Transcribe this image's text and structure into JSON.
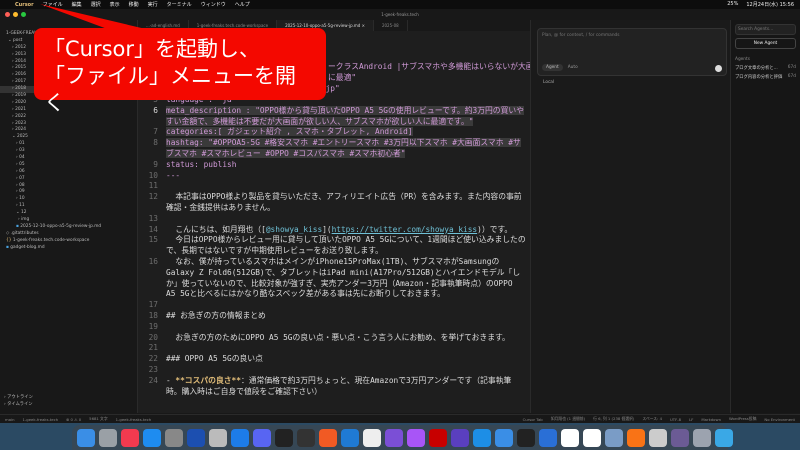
{
  "menubar": {
    "app": "Cursor",
    "items": [
      "ファイル",
      "編集",
      "選択",
      "表示",
      "移動",
      "実行",
      "ターミナル",
      "ウィンドウ",
      "ヘルプ"
    ],
    "battery": "25%",
    "datetime": "12月24日(水)  15:56"
  },
  "window": {
    "title": "1-geek-freaks.tech"
  },
  "sidebar": {
    "root": "1-GEEK-FREAKS",
    "folder": "post",
    "years": [
      "2012",
      "2013",
      "2014",
      "2015",
      "2016",
      "2017",
      "2018",
      "2019",
      "2020",
      "2021",
      "2022",
      "2023",
      "2024",
      "2025"
    ],
    "months": [
      "01",
      "03",
      "04",
      "05",
      "06",
      "07",
      "08",
      "09",
      "10",
      "11",
      "12"
    ],
    "subfolder": "img",
    "file": "2025-12-10-oppo-a5-5g-review-jp.md",
    "root_files": [
      ".gitattributes",
      "1-geek-freaks.tech.code-workspace",
      "gadget-blog.md"
    ],
    "outline": "アウトライン",
    "timeline": "タイムライン"
  },
  "tabs": [
    "...-ad-english.md",
    "1-geek-freaks.tech.code-workspace",
    "2025-12-10-oppo-a5-5g-review-jp.md",
    "2025-08"
  ],
  "code": {
    "l3a": "ークラスAndroid |サブスマホや多機能はいらないが大画面",
    "l3b": "に最適\"",
    "l4": "slug: \"20251209-oppo-a5-5g-review-jp\"",
    "l5": "language : \"ja\"",
    "l6k": "meta_description : ",
    "l6v": "\"OPPO様から貸与頂いたOPPO A5 5Gの使用レビューです。約3万円の買いやすい金額で、多機能は不要だが大画面が欲しい人、サブスマホが欲しい人に最適です。\"",
    "l7": "categories:[ ガジェット紹介 , スマホ・タブレット, Android]",
    "l8": "hashtag: \"#OPPOA5-5G #格安スマホ #エントリースマホ #3万円以下スマホ #大画面スマホ #サブスマホ #スマホレビュー #OPPO #コスパスマホ #スマホ初心者\"",
    "l9k": "status: ",
    "l9v": "publish",
    "l10": "---",
    "l12": "  本記事はOPPO様より製品を貸与いただき、アフィリエイト広告（PR）を含みます。また内容の事前確認・金銭提供はありません。",
    "l14a": "  こんにちは、如月翔也（[",
    "l14m": "@showya_kiss",
    "l14b": "](",
    "l14l": "https://twitter.com/showya_kiss",
    "l14c": ")）です。",
    "l15": "  今日はOPPO様からレビュー用に貸与して頂いたOPPO A5 5Gについて、1週間ほど使い込みましたので、長期ではないですが中期使用レビューをお送り致します。",
    "l16": "  なお、僕が持っているスマホはメインがiPhone15ProMax(1TB)、サブスマホがSamsungのGalaxy Z Fold6(512GB)で、タブレットはiPad mini(A17Pro/512GB)とハイエンドモデル「しか」使っていないので、比較対象が強すぎ、実売アンダー3万円（Amazon・記事執筆時点）のOPPO A5 5Gと比べるにはかなり酷なスペック差がある事は先にお断りしておきます。",
    "l18": "## お急ぎの方の情報まとめ",
    "l20": "  お急ぎの方のためにOPPO A5 5Gの良い点・悪い点・こう言う人にお勧め、を挙げておきます。",
    "l22": "### OPPO A5 5Gの良い点",
    "l24a": "- ",
    "l24b": "**コスパの良さ**",
    "l24c": "：通常価格で約3万円ちょっと、現在Amazonで3万円アンダーです（記事執筆時。購入時はご自身で値段をご確認下さい）"
  },
  "agent": {
    "placeholder": "Plan, @ for context, / for commands",
    "mode": "Agent",
    "model": "Auto",
    "env": "Local",
    "search_placeholder": "Search Agents...",
    "new_agent": "New Agent",
    "agents_label": "Agents",
    "agents": [
      {
        "title": "ブログ文章の分析と...",
        "age": "67d"
      },
      {
        "title": "ブログ内容の分析と評価",
        "age": "67d"
      }
    ]
  },
  "status": {
    "branch": "main",
    "site": "1-geek-freaks.tech",
    "problems": "⊗ 0 ⚠ 0",
    "chars": "5681 文字",
    "workspace": "1-geek-freaks.tech",
    "tab": "Cursor Tab",
    "author": "如月翔也 (1 週間前)",
    "pos": "行 6, 列 1 (238 個選択)",
    "spaces": "スペース: 4",
    "enc": "UTF-8",
    "eol": "LF",
    "lang": "Markdown",
    "wp": "WordPress投稿",
    "env": "No Environment"
  },
  "callout": {
    "line1": "「Cursor」を起動し、",
    "line2": "「ファイル」メニューを開く"
  },
  "dock": {
    "colors": [
      "#3a8ee6",
      "#9aa0a6",
      "#f23a4f",
      "#1e8cf0",
      "#888",
      "#1c4fb0",
      "#bbb",
      "#1d7ce8",
      "#5865f2",
      "#222",
      "#333",
      "#f15a24",
      "#1f7ad4",
      "#eee",
      "#7b4fd6",
      "#a855f7",
      "#c70000",
      "#5a3fbf",
      "#1d8ee6",
      "#3a8ee6",
      "#222",
      "#2a6fd6",
      "#fff",
      "#fff",
      "#7a9cc6",
      "#f97316",
      "#ccc",
      "#6b5b95",
      "#9ca3af",
      "#3aa8e6"
    ]
  }
}
